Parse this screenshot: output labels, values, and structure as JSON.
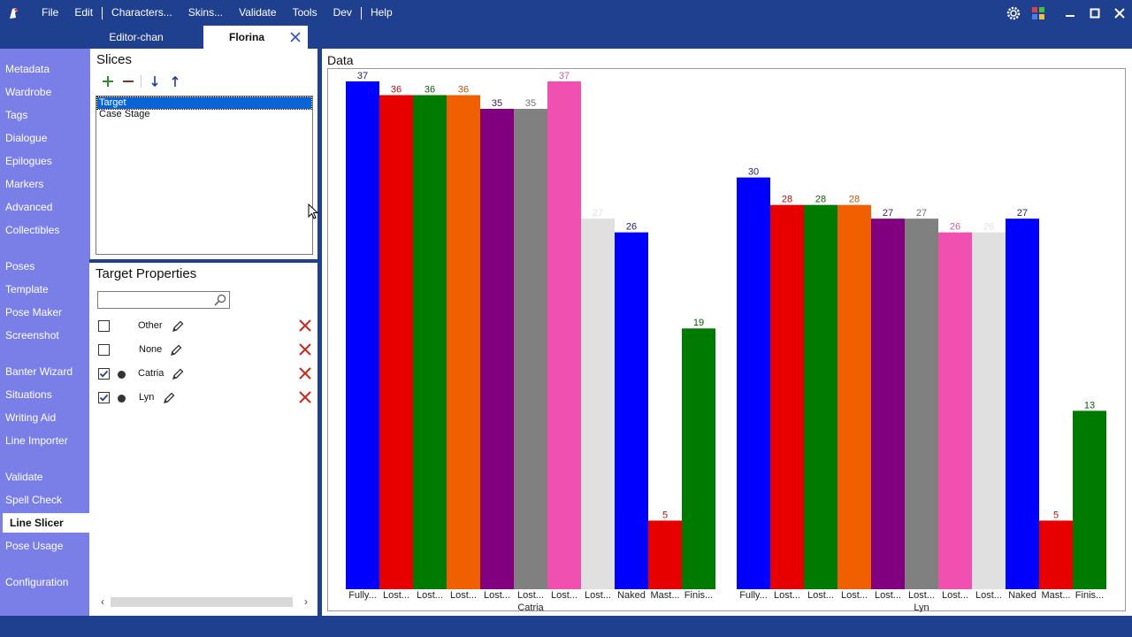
{
  "menu": {
    "items": [
      "File",
      "Edit",
      "Characters...",
      "Skins...",
      "Validate",
      "Tools",
      "Dev",
      "Help"
    ]
  },
  "tabs": {
    "editor": "Editor-chan",
    "florina": "Florina"
  },
  "sidebar": {
    "items": [
      {
        "label": "Metadata"
      },
      {
        "label": "Wardrobe"
      },
      {
        "label": "Tags"
      },
      {
        "label": "Dialogue"
      },
      {
        "label": "Epilogues"
      },
      {
        "label": "Markers"
      },
      {
        "label": "Advanced"
      },
      {
        "label": "Collectibles"
      },
      {
        "label": "Poses"
      },
      {
        "label": "Template"
      },
      {
        "label": "Pose Maker"
      },
      {
        "label": "Screenshot"
      },
      {
        "label": "Banter Wizard"
      },
      {
        "label": "Situations"
      },
      {
        "label": "Writing Aid"
      },
      {
        "label": "Line Importer"
      },
      {
        "label": "Validate"
      },
      {
        "label": "Spell Check"
      },
      {
        "label": "Line Slicer"
      },
      {
        "label": "Pose Usage"
      },
      {
        "label": "Configuration"
      }
    ]
  },
  "slices": {
    "title": "Slices",
    "items": [
      "Target",
      "Case Stage"
    ]
  },
  "target_props": {
    "title": "Target Properties",
    "search_value": "",
    "rows": [
      {
        "label": "Other",
        "checked": false,
        "dot": false
      },
      {
        "label": "None",
        "checked": false,
        "dot": false
      },
      {
        "label": "Catria",
        "checked": true,
        "dot": true
      },
      {
        "label": "Lyn",
        "checked": true,
        "dot": true
      }
    ]
  },
  "data_panel": {
    "title": "Data"
  },
  "colors": {
    "series": [
      "#0000ff",
      "#e60000",
      "#007a00",
      "#f06000",
      "#800080",
      "#808080",
      "#f050b0",
      "#e0e0e0",
      "#0000ff",
      "#e60000",
      "#007a00"
    ],
    "label_colors": [
      "#1f1f6f",
      "#b01010",
      "#0a5a0a",
      "#c05000",
      "#4a1a4a",
      "#707070",
      "#c060a0",
      "#e0e0e0",
      "#1f1f6f",
      "#b01010",
      "#0a5a0a"
    ]
  },
  "chart_data": {
    "type": "bar",
    "ylim": [
      0,
      37
    ],
    "groups": [
      {
        "name": "Catria",
        "categories": [
          "Fully...",
          "Lost...",
          "Lost...",
          "Lost...",
          "Lost...",
          "Lost...",
          "Lost...",
          "Lost...",
          "Naked",
          "Mast...",
          "Finis..."
        ],
        "values": [
          37,
          36,
          36,
          36,
          35,
          35,
          37,
          27,
          26,
          5,
          19
        ]
      },
      {
        "name": "Lyn",
        "categories": [
          "Fully...",
          "Lost...",
          "Lost...",
          "Lost...",
          "Lost...",
          "Lost...",
          "Lost...",
          "Lost...",
          "Naked",
          "Mast...",
          "Finis..."
        ],
        "values": [
          30,
          28,
          28,
          28,
          27,
          27,
          26,
          26,
          27,
          5,
          13
        ]
      }
    ]
  }
}
